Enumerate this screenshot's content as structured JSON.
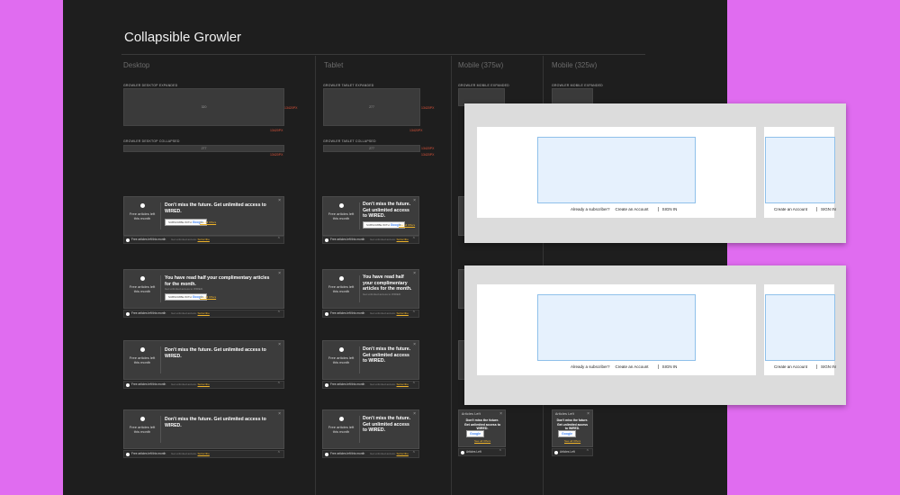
{
  "page": {
    "title": "Collapsible Growler"
  },
  "columns": [
    "Desktop",
    "Tablet",
    "Mobile (375w)",
    "Mobile (325w)"
  ],
  "spec": {
    "desktop_expanded": "GROWLER DESKTOP EXPANDED",
    "desktop_collapsed": "GROWLER DESKTOP COLLAPSED",
    "tablet_expanded": "GROWLER TABLET EXPANDED",
    "tablet_collapsed": "GROWLER TABLET COLLAPSED",
    "mobile_expanded": "GROWLER MOBILE EXPANDED",
    "mobile_325_expanded": "GROWLER MOBILE EXPANDED",
    "ph_desktop": "320",
    "ph_tablet": "277",
    "ph_collapsed": "277",
    "red1": "13420PX",
    "red2": "13420PX",
    "red3": "13420PX",
    "red4": "13420PX"
  },
  "growler": {
    "left_label": "Free articles left this month",
    "headline_a": "Don't miss the future. Get unlimited access to WIRED.",
    "headline_b": "You have read half your complimentary articles for the month.",
    "headline_c": "Don't miss the future. Get unlimited access to WIRED.",
    "sub_b": "Get unlimited access to WIRED.",
    "button_prefix": "SUBSCRIBE WITH",
    "button_brand": "Google",
    "link": "See all Offers",
    "bar_label": "Free articles left this month",
    "bar_sub": "Get unlimited access.",
    "bar_link": "Subscribe",
    "mobile_articles_left": "Articles Left",
    "mobile_headline": "Don't miss the future. Get unlimited access to WIRED."
  },
  "panels": {
    "already": "Already a subscriber?",
    "create": "Create an Account",
    "signin": "SIGN IN"
  },
  "colors": {
    "background": "#e06cf0",
    "board": "#1e1e1e",
    "accent": "#f0b429",
    "spec_red": "#e3543a",
    "blue_fill": "#e6f1fd"
  }
}
